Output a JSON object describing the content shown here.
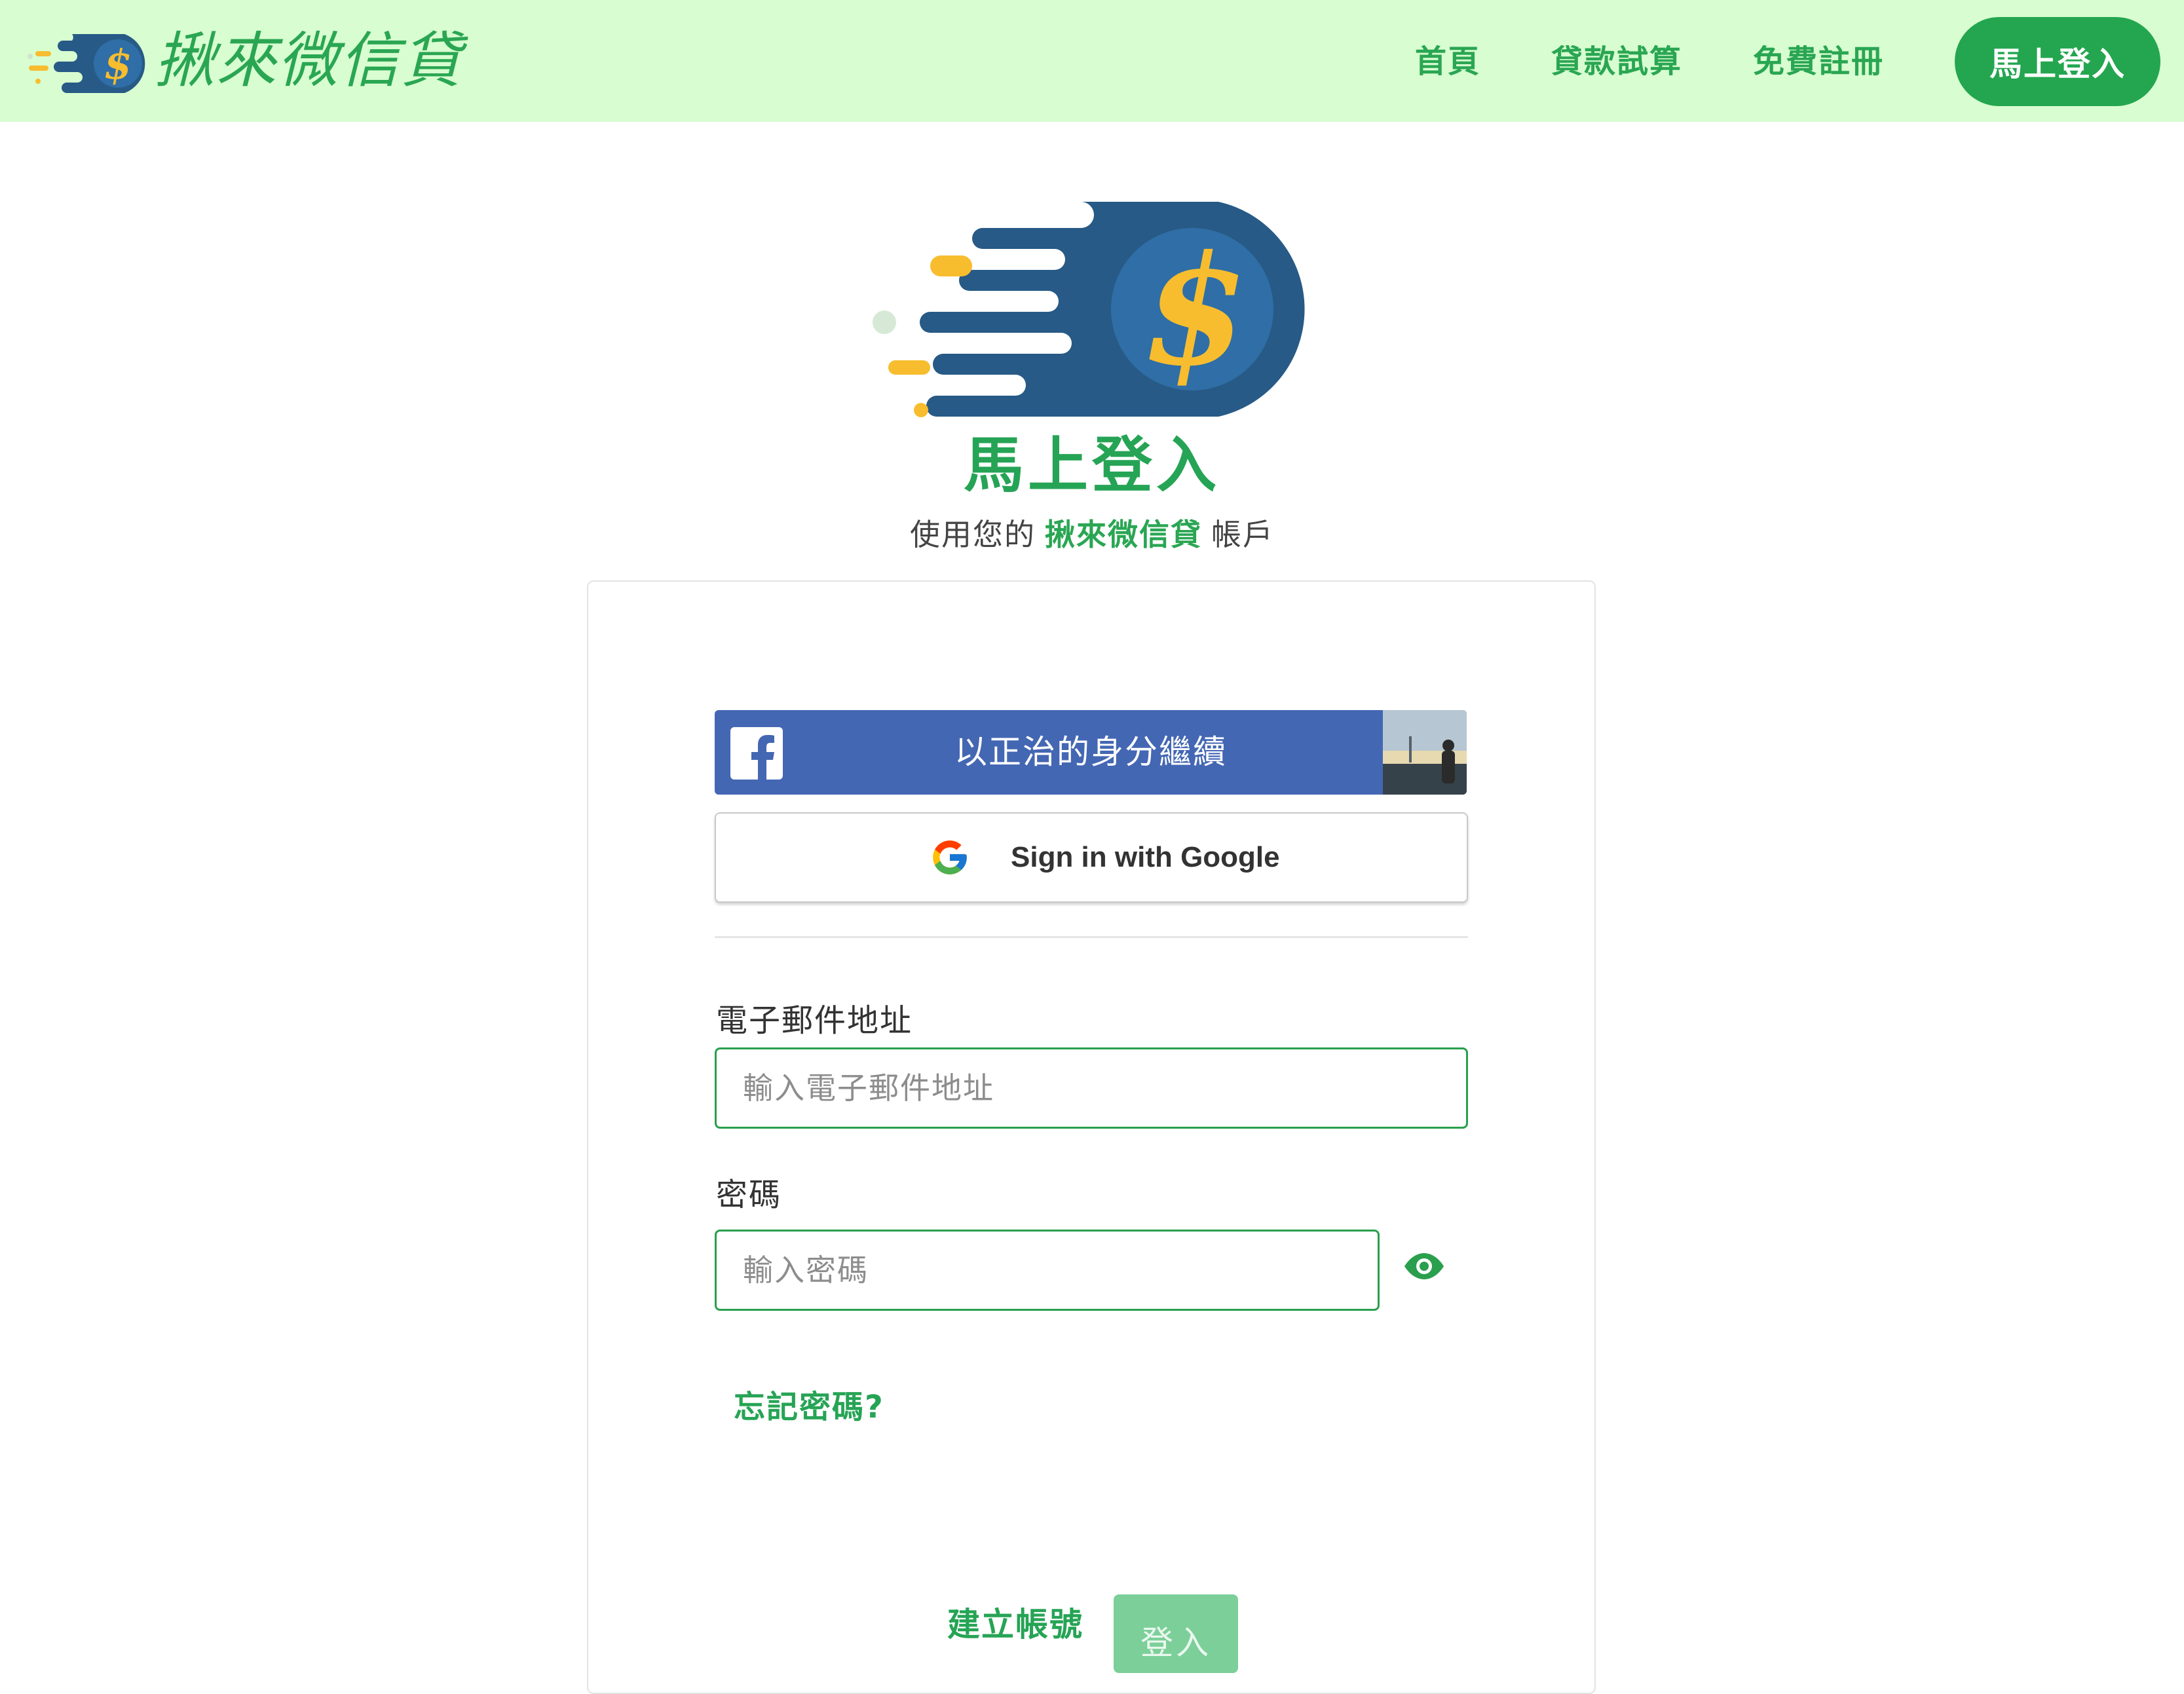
{
  "nav": {
    "brand_name": "揪來微信貸",
    "links": [
      "首頁",
      "貸款試算",
      "免費註冊"
    ],
    "login_button": "馬上登入"
  },
  "hero": {
    "title": "馬上登入",
    "subtitle_prefix": "使用您的",
    "subtitle_brand": "揪來微信貸",
    "subtitle_suffix": "帳戶"
  },
  "social": {
    "facebook_label": "以正治的身分繼續",
    "google_label": "Sign in with Google"
  },
  "form": {
    "email_label": "電子郵件地址",
    "email_placeholder": "輸入電子郵件地址",
    "email_value": "",
    "password_label": "密碼",
    "password_placeholder": "輸入密碼",
    "password_value": "",
    "forgot_link": "忘記密碼?",
    "create_account": "建立帳號",
    "submit": "登入"
  },
  "colors": {
    "navbar_bg": "#d8fdd0",
    "accent_green": "#26a455",
    "facebook_blue": "#4467b3",
    "logo_navy": "#275a86",
    "logo_yellow": "#f7bd2f"
  },
  "icons": [
    "dollar-coin-logo",
    "facebook-icon",
    "google-icon",
    "eye-icon",
    "profile-avatar"
  ]
}
